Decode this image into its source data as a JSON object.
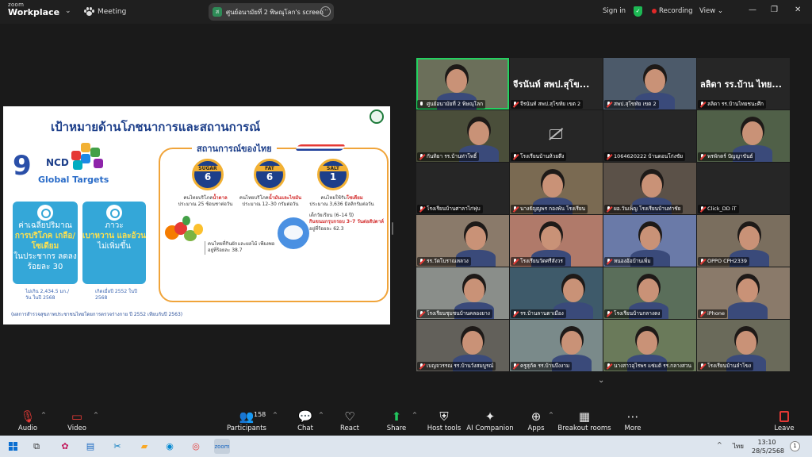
{
  "titlebar": {
    "brand_top": "zoom",
    "brand_bottom": "Workplace",
    "chevron": "⌄",
    "meeting": "Meeting",
    "share_label": "ศูนย์อนามัยที่ 2 พิษณุโลก's screen",
    "share_more": "···",
    "sign_in": "Sign in",
    "recording": "Recording",
    "view": "View",
    "view_caret": "⌄",
    "minimize": "—",
    "restore": "❐",
    "close": "✕"
  },
  "slide": {
    "title": "เป้าหมายด้านโภชนาการและสถานการณ์",
    "ncd_nine": "9",
    "ncd_ncd": "NCD",
    "ncd_global": "Global Targets",
    "target1_pre": "ค่าเฉลี่ยปริมาณ",
    "target1_hl": "การบริโภค เกลือ/โซเดียม",
    "target1_post": "ในประชากร ลดลงร้อยละ 30",
    "target2_pre": "ภาวะ",
    "target2_hl": "เบาหวาน และอ้วน",
    "target2_post": "ไม่เพิ่มขึ้น",
    "note1": "ไม่เกิน 2,434.5 มก./วัน ในปี 2568",
    "note2": "เกิดเมื่อปี 2552 ในปี 2568",
    "footer": "(ผลการสำรวจสุขภาพประชาชนไทยโดยการตรวจร่างกาย ปี 2552 เทียบกับปี 2563)",
    "situation_title": "สถานการณ์ของไทย",
    "sugar_label": "SUGAR",
    "sugar_num": "6",
    "fat_label": "FAT",
    "fat_num": "6",
    "salt_label": "SALT",
    "salt_num": "1",
    "sugar_text_a": "คนไทยบริโภค",
    "sugar_text_red": "น้ำตาล",
    "sugar_text_b": "ประมาณ 25 ช้อนชาต่อวัน",
    "fat_text_a": "คนไทยบริโภค",
    "fat_text_red": "น้ำมันและไขมัน",
    "fat_text_b": "ประมาณ 12–30 กรัมต่อวัน",
    "salt_text_a": "คนไทยใช้รับ",
    "salt_text_red": "โซเดียม",
    "salt_text_b": "ประมาณ 3,636 มิลลิกรัมต่อวัน",
    "veg_text": "คนไทยที่กินผักและผลไม้ เพียงพอ อยู่ที่ร้อยละ 38.7",
    "kids_text_a": "เด็กวัยเรียน (6–14 ปี)",
    "kids_text_red": "กินขนมกรุบกรอบ 3–7 วันต่อสัปดาห์",
    "kids_text_b": "อยู่ที่ร้อยละ 62.3"
  },
  "gallery": {
    "tiles": [
      {
        "name": "ศูนย์อนามัยที่ 2 พิษณุโลก",
        "big": "",
        "muted": false
      },
      {
        "name": "จีรนันท์ สพป.สุโขทัย เขต 2",
        "big": "จีรนันท์ สพป.สุโข...",
        "muted": true
      },
      {
        "name": "สพป.สุโขทัย เขต 2",
        "big": "",
        "muted": true
      },
      {
        "name": "ลลิดา รร.บ้านไทยชนะศึก",
        "big": "ลลิดา รร.บ้าน ไทย...",
        "muted": true
      },
      {
        "name": "กันทิยา รร.บ้านท่าโพธิ์",
        "big": "",
        "muted": true
      },
      {
        "name": "โรงเรียนบ้านห้วยตึง",
        "big": "",
        "muted": true
      },
      {
        "name": "1064620222 บ้านดอนโก่งชัย",
        "big": "",
        "muted": true
      },
      {
        "name": "พรพักตร์ ปัญญาขันธ์",
        "big": "",
        "muted": true
      },
      {
        "name": "โรงเรียนบ้านศาลาไก่ฟุบ",
        "big": "",
        "muted": true
      },
      {
        "name": "นางธัญญพร กองพัน โรงเรียน",
        "big": "",
        "muted": true
      },
      {
        "name": "ผอ.วันเพ็ญ โรงเรียนบ้านท่าชัย",
        "big": "",
        "muted": true
      },
      {
        "name": "Click_DD iT",
        "big": "",
        "muted": true
      },
      {
        "name": "รร.วัดโบราณหลวง",
        "big": "",
        "muted": true
      },
      {
        "name": "โรงเรียนวัดศรีสังวร",
        "big": "",
        "muted": true
      },
      {
        "name": "หนองอ้อบ้านเพิ่ม",
        "big": "",
        "muted": true
      },
      {
        "name": "OPPO CPH2339",
        "big": "",
        "muted": true
      },
      {
        "name": "โรงเรียนชุมชนบ้านคลองยาง",
        "big": "",
        "muted": true
      },
      {
        "name": "รร.บ้านลานตาเมือง",
        "big": "",
        "muted": true
      },
      {
        "name": "โรงเรียนบ้านกลางดง",
        "big": "",
        "muted": true
      },
      {
        "name": "iPhone",
        "big": "",
        "muted": true
      },
      {
        "name": "เบญจวรรณ รร.บ้านวังสมบูรณ์",
        "big": "",
        "muted": true
      },
      {
        "name": "ครูสุภัค รร.บ้านบึงงาม",
        "big": "",
        "muted": true
      },
      {
        "name": "นางสาวอุไรพร แซ่แต้ รร.กลางสวน",
        "big": "",
        "muted": true
      },
      {
        "name": "โรงเรียนบ้านลำโขง",
        "big": "",
        "muted": true
      }
    ],
    "more_chevron": "⌄"
  },
  "toolbar": {
    "audio": "Audio",
    "video": "Video",
    "participants": "Participants",
    "participants_count": "158",
    "chat": "Chat",
    "react": "React",
    "share": "Share",
    "host_tools": "Host tools",
    "ai_companion": "AI Companion",
    "apps": "Apps",
    "breakout": "Breakout rooms",
    "more": "More",
    "leave": "Leave",
    "caret": "^"
  },
  "taskbar": {
    "lang": "ไทย",
    "time": "13:10",
    "date": "28/5/2568",
    "notif": "1",
    "tray_caret": "^"
  },
  "colors": {
    "active_speaker": "#23d160",
    "recording": "#e02828",
    "muted": "#e53935"
  }
}
